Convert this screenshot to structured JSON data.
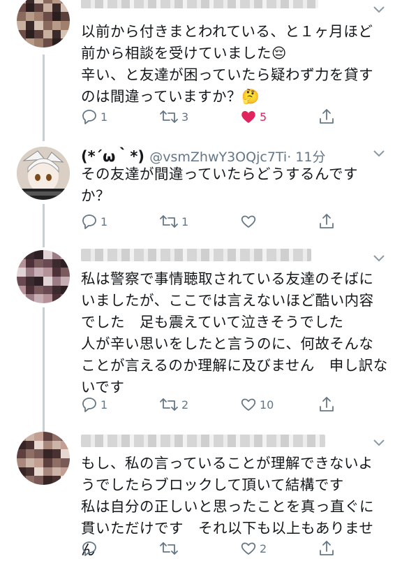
{
  "tweets": [
    {
      "author_name": "",
      "author_handle": "",
      "time": "",
      "text": "以前から付きまとわれている、と１ヶ月ほど\n前から相談を受けていました😔\n辛い、と友達が困っていたら疑わず力を貸す\nのは間違っていますか？🤔",
      "replies": "1",
      "retweets": "3",
      "likes": "5",
      "liked": true
    },
    {
      "author_name": "(*´ω｀*)",
      "author_handle": "@vsmZhwY3OQjc7Ti",
      "time": "· 11分",
      "text": "その友達が間違っていたらどうするんです\nか？",
      "replies": "1",
      "retweets": "1",
      "likes": "",
      "liked": false
    },
    {
      "author_name": "",
      "author_handle": "",
      "time": "",
      "text": "私は警察で事情聴取されている友達のそばに\nいましたが、ここでは言えないほど酷い内容\nでした　足も震えていて泣きそうでした\n人が辛い思いをしたと言うのに、何故そんな\nことが言えるのか理解に及びません　申し訳な\nいです",
      "replies": "1",
      "retweets": "2",
      "likes": "10",
      "liked": false
    },
    {
      "author_name": "",
      "author_handle": "",
      "time": "",
      "text": "もし、私の言っていることが理解できないよ\nうでしたらブロックして頂いて結構です\n私は自分の正しいと思ったことを真っ直ぐに\n貫いただけです　それ以下も以上もありません",
      "replies": "",
      "retweets": "",
      "likes": "2",
      "liked": false
    }
  ],
  "colors": {
    "icon_gray": "#657786",
    "like_red": "#e0245e",
    "thread_line": "#c4cfd6"
  },
  "icons": [
    "reply-icon",
    "retweet-icon",
    "like-icon",
    "share-icon",
    "chevron-down-icon"
  ]
}
